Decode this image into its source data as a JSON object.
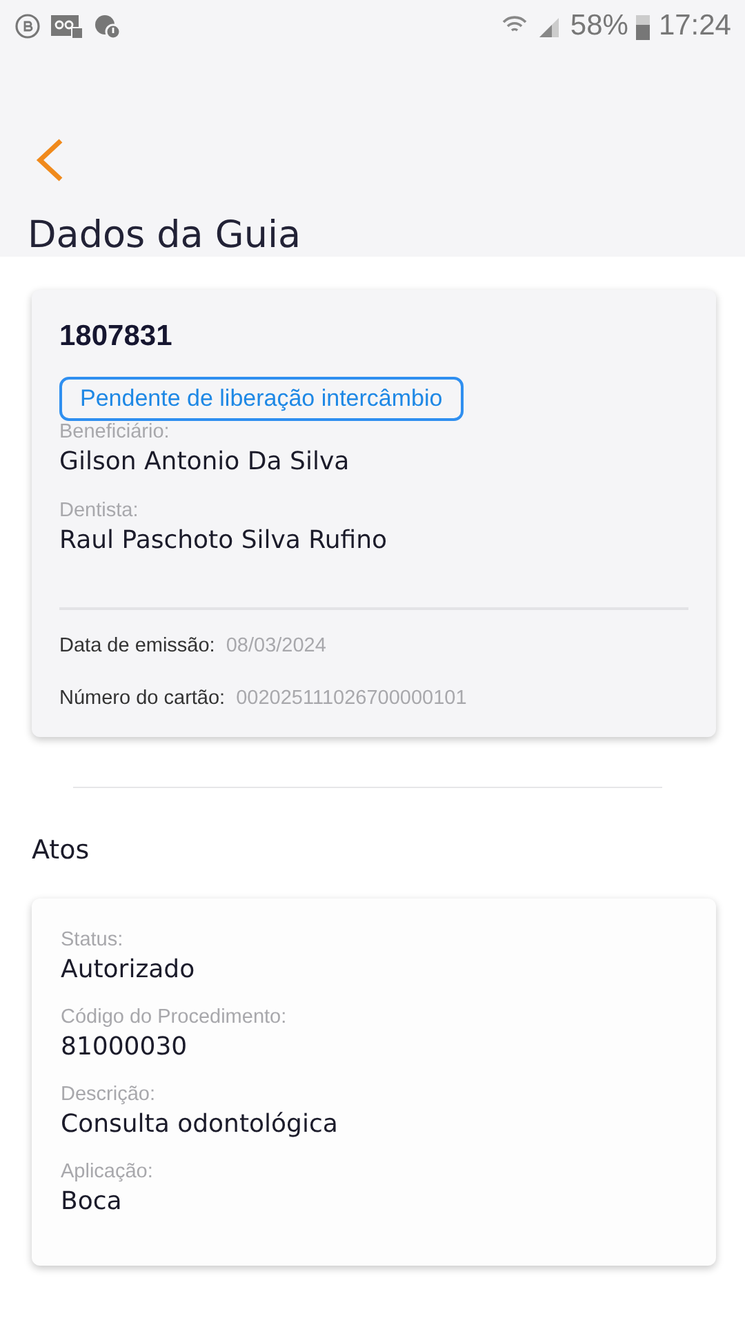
{
  "status_bar": {
    "battery": "58%",
    "time": "17:24"
  },
  "header": {
    "title": "Dados da Guia"
  },
  "guide": {
    "number": "1807831",
    "status_badge": "Pendente de liberação intercâmbio",
    "fields": [
      {
        "label": "Beneficiário:",
        "value": "Gilson Antonio Da Silva"
      },
      {
        "label": "Dentista:",
        "value": "Raul Paschoto Silva Rufino"
      }
    ],
    "details": [
      {
        "label": "Data de emissão:",
        "value": "08/03/2024"
      },
      {
        "label": "Número do cartão:",
        "value": "002025111026700000101"
      }
    ]
  },
  "acts": {
    "title": "Atos",
    "items": [
      {
        "fields": [
          {
            "label": "Status:",
            "value": "Autorizado"
          },
          {
            "label": "Código do Procedimento:",
            "value": "81000030"
          },
          {
            "label": "Descrição:",
            "value": "Consulta odontológica"
          },
          {
            "label": "Aplicação:",
            "value": "Boca"
          }
        ]
      }
    ]
  }
}
